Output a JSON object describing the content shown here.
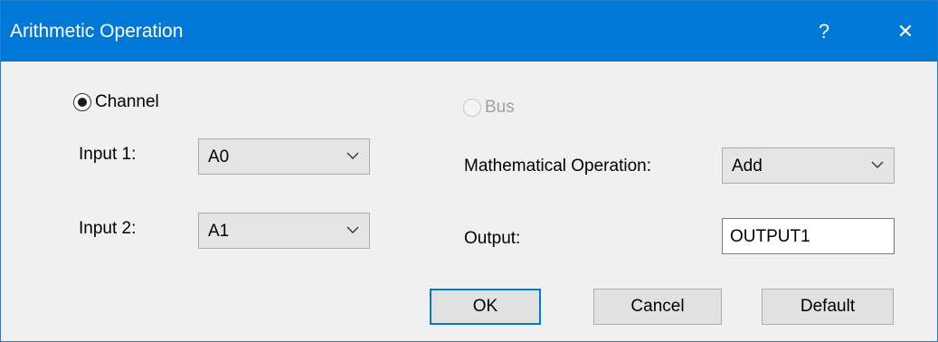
{
  "window": {
    "title": "Arithmetic Operation",
    "help_label": "?",
    "close_label": "✕"
  },
  "source": {
    "channel_label": "Channel",
    "channel_selected": true,
    "bus_label": "Bus",
    "bus_enabled": false
  },
  "inputs": {
    "input1_label": "Input 1:",
    "input1_value": "A0",
    "input2_label": "Input 2:",
    "input2_value": "A1"
  },
  "operation": {
    "label": "Mathematical Operation:",
    "value": "Add"
  },
  "output": {
    "label": "Output:",
    "value": "OUTPUT1"
  },
  "buttons": {
    "ok_label": "OK",
    "cancel_label": "Cancel",
    "default_label": "Default"
  },
  "colors": {
    "titlebar": "#0078d7",
    "dialog_bg": "#f0f0f0",
    "focus_border": "#0078d7"
  }
}
